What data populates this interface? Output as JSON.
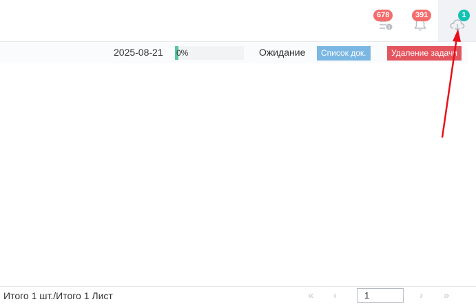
{
  "header": {
    "messages_badge": "678",
    "notifications_badge": "391",
    "downloads_badge": "1"
  },
  "task": {
    "date": "2025-08-21",
    "progress_text": "0%",
    "progress_value": 0,
    "status": "Ожидание",
    "doclist_label": "Список док.",
    "delete_label": "Удаление задачи"
  },
  "footer": {
    "summary": "Итого 1 шт./Итого 1 Лист",
    "first_page": "«",
    "prev_page": "‹",
    "next_page": "›",
    "last_page": "»",
    "page_value": "1"
  },
  "colors": {
    "badge_red": "#f56c6c",
    "badge_teal": "#13c2b3",
    "doclist_blue": "#7bb7e3",
    "delete_red": "#e4545e",
    "arrow_red": "#e8101a"
  }
}
